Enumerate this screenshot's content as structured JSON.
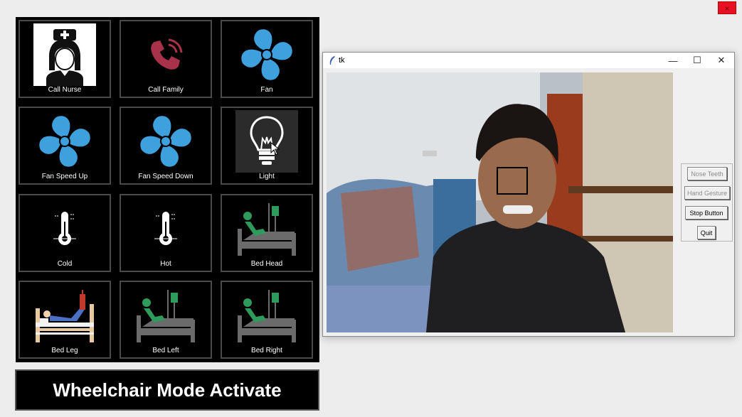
{
  "corner": {
    "close_glyph": "×"
  },
  "tiles": [
    {
      "label": "Call Nurse",
      "icon": "nurse-icon"
    },
    {
      "label": "Call Family",
      "icon": "phone-icon"
    },
    {
      "label": "Fan",
      "icon": "fan-icon"
    },
    {
      "label": "Fan Speed Up",
      "icon": "fan-icon"
    },
    {
      "label": "Fan Speed Down",
      "icon": "fan-icon"
    },
    {
      "label": "Light",
      "icon": "lightbulb-icon"
    },
    {
      "label": "Cold",
      "icon": "thermometer-icon"
    },
    {
      "label": "Hot",
      "icon": "thermometer-icon"
    },
    {
      "label": "Bed Head",
      "icon": "bed-icon"
    },
    {
      "label": "Bed Leg",
      "icon": "bed-leg-icon"
    },
    {
      "label": "Bed Left",
      "icon": "bed-icon"
    },
    {
      "label": "Bed Right",
      "icon": "bed-icon"
    }
  ],
  "status": {
    "text": "Wheelchair Mode Activate"
  },
  "window": {
    "title": "tk",
    "minimize_glyph": "—",
    "maximize_glyph": "☐",
    "close_glyph": "✕"
  },
  "buttons": {
    "nose_teeth": "Nose Teeth",
    "hand_gesture": "Hand Gesture",
    "stop_button": "Stop Button",
    "quit": "Quit"
  },
  "colors": {
    "fan_blue": "#3ea0dc",
    "phone_red": "#a8324a",
    "bed_green": "#2e9a5c",
    "bed_gray": "#6b6b6b"
  }
}
